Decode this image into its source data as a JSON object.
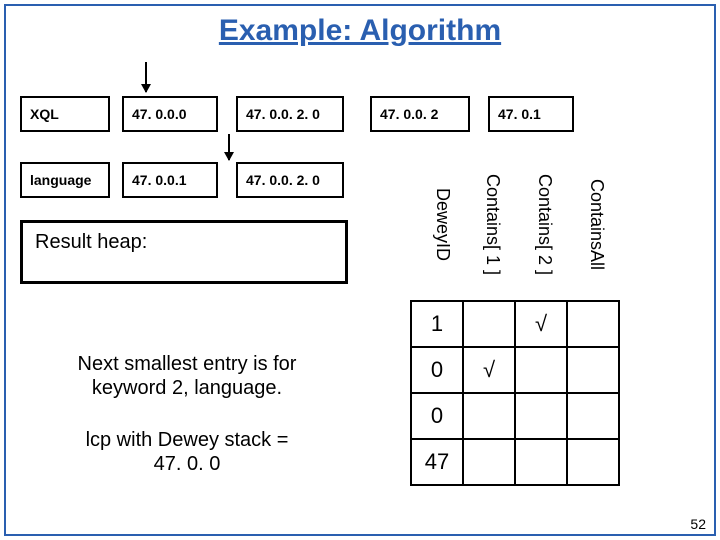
{
  "title": "Example: Algorithm",
  "row1": {
    "c0": "XQL",
    "c1": "47. 0.0.0",
    "c2": "47. 0.0. 2. 0",
    "c3": "47. 0.0. 2",
    "c4": "47. 0.1"
  },
  "row2": {
    "c0": "language",
    "c1": "47. 0.0.1",
    "c2": "47. 0.0. 2. 0"
  },
  "result_heap_label": "Result heap:",
  "caption1_line1": "Next smallest entry is for",
  "caption1_line2": "keyword 2, language.",
  "caption2_line1": "lcp with Dewey stack =",
  "caption2_line2": "47. 0. 0",
  "table_headers": {
    "h0": "DeweyID",
    "h1": "Contains[ 1 ]",
    "h2": "Contains[ 2 ]",
    "h3": "ContainsAll"
  },
  "table_rows": [
    {
      "c0": "1",
      "c1": "",
      "c2": "√",
      "c3": ""
    },
    {
      "c0": "0",
      "c1": "√",
      "c2": "",
      "c3": ""
    },
    {
      "c0": "0",
      "c1": "",
      "c2": "",
      "c3": ""
    },
    {
      "c0": "47",
      "c1": "",
      "c2": "",
      "c3": ""
    }
  ],
  "pagenum": "52"
}
